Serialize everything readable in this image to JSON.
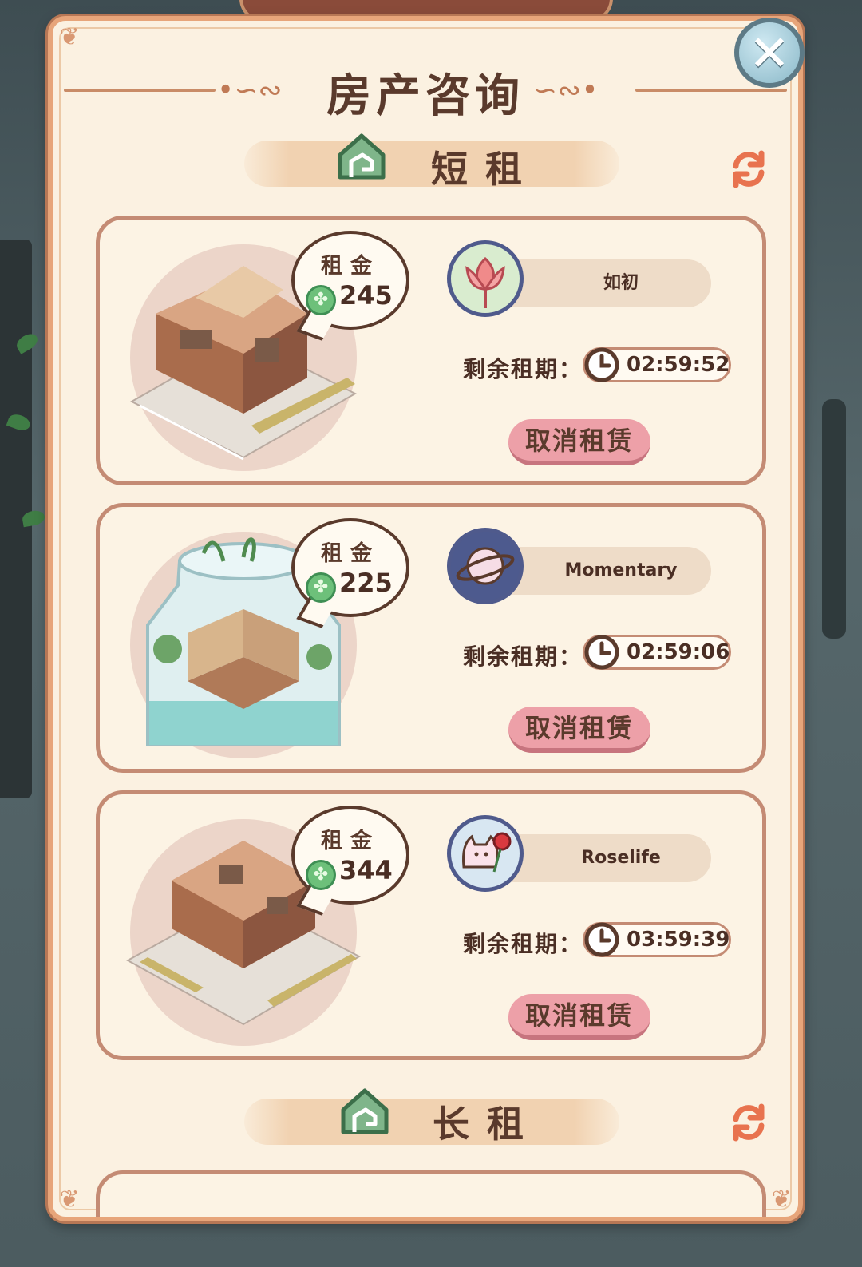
{
  "header": {
    "title": "房产咨询",
    "bg_sign_text": ""
  },
  "sections": [
    {
      "label": "短租"
    },
    {
      "label": "长租"
    }
  ],
  "listings": [
    {
      "rent_label": "租金",
      "rent": "245",
      "tenant": "如初",
      "lease_label": "剩余租期：",
      "time_left": "02:59:52",
      "cancel_label": "取消租赁",
      "illustration": "two-floor-house",
      "avatar": "lotus"
    },
    {
      "rent_label": "租金",
      "rent": "225",
      "tenant": "Momentary",
      "lease_label": "剩余租期：",
      "time_left": "02:59:06",
      "cancel_label": "取消租赁",
      "illustration": "terrarium-jar",
      "avatar": "planet"
    },
    {
      "rent_label": "租金",
      "rent": "344",
      "tenant": "Roselife",
      "lease_label": "剩余租期：",
      "time_left": "03:59:39",
      "cancel_label": "取消租赁",
      "illustration": "isometric-house-large",
      "avatar": "cat-with-rose"
    }
  ],
  "colors": {
    "accent": "#5a3a2c",
    "panel": "#fbf1e1",
    "border": "#c48b74",
    "button": "#eda0a8",
    "coin": "#6dc07a"
  }
}
